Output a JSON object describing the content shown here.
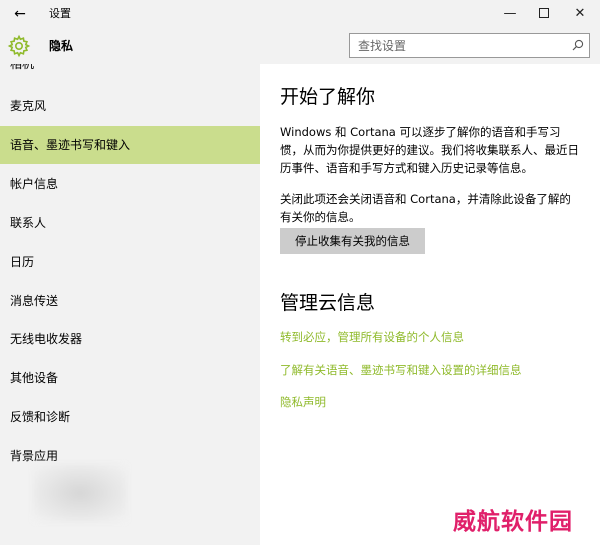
{
  "window": {
    "title": "设置",
    "back_glyph": "←",
    "minimize_glyph": "—",
    "close_glyph": "✕"
  },
  "header": {
    "title": "隐私",
    "search_placeholder": "查找设置"
  },
  "sidebar": {
    "items": [
      {
        "label": "相机",
        "selected": false
      },
      {
        "label": "麦克风",
        "selected": false
      },
      {
        "label": "语音、墨迹书写和键入",
        "selected": true
      },
      {
        "label": "帐户信息",
        "selected": false
      },
      {
        "label": "联系人",
        "selected": false
      },
      {
        "label": "日历",
        "selected": false
      },
      {
        "label": "消息传送",
        "selected": false
      },
      {
        "label": "无线电收发器",
        "selected": false
      },
      {
        "label": "其他设备",
        "selected": false
      },
      {
        "label": "反馈和诊断",
        "selected": false
      },
      {
        "label": "背景应用",
        "selected": false
      }
    ]
  },
  "main": {
    "section1_title": "开始了解你",
    "paragraph1": "Windows 和 Cortana 可以逐步了解你的语音和手写习惯，从而为你提供更好的建议。我们将收集联系人、最近日历事件、语音和手写方式和键入历史记录等信息。",
    "paragraph2": "关闭此项还会关闭语音和 Cortana，并清除此设备了解的有关你的信息。",
    "stop_button": "停止收集有关我的信息",
    "section2_title": "管理云信息",
    "links": [
      "转到必应，管理所有设备的个人信息",
      "了解有关语音、墨迹书写和键入设置的详细信息",
      "隐私声明"
    ]
  },
  "watermark": "威航软件园",
  "colors": {
    "accent_selected": "#cadd8d",
    "link": "#8fba2b",
    "sidebar_bg": "#f2f2f2",
    "button_bg": "#cccccc",
    "watermark": "#e0206a"
  },
  "icons": {
    "back": "back-arrow-icon",
    "gear": "gear-icon",
    "search": "search-icon",
    "minimize": "minimize-icon",
    "maximize": "maximize-icon",
    "close": "close-icon"
  }
}
